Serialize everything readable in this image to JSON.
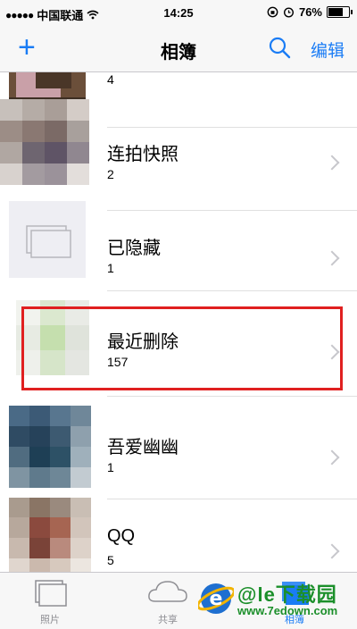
{
  "status_bar": {
    "carrier": "中国联通",
    "time": "14:25",
    "battery": "76%",
    "battery_level": 0.76,
    "signal_icon": "signal-dots-icon",
    "wifi_icon": "wifi-icon"
  },
  "nav_bar": {
    "add_label": "+",
    "title": "相簿",
    "edit_label": "编辑",
    "search_icon": "search-icon"
  },
  "albums": [
    {
      "name": "",
      "count": "4"
    },
    {
      "name": "连拍快照",
      "count": "2"
    },
    {
      "name": "已隐藏",
      "count": "1"
    },
    {
      "name": "最近删除",
      "count": "157"
    },
    {
      "name": "吾爱幽幽",
      "count": "1"
    },
    {
      "name": "QQ",
      "count": "5"
    }
  ],
  "tabs": [
    {
      "label": "照片",
      "icon": "photos-tab-icon"
    },
    {
      "label": "共享",
      "icon": "cloud-icon"
    },
    {
      "label": "相簿",
      "icon": "albums-tab-icon",
      "active": true
    }
  ],
  "watermark": {
    "brand": "@le下载园",
    "url": "www.7edown.com"
  },
  "colors": {
    "accent": "#1a7cf5",
    "highlight_border": "#e02020",
    "watermark": "#1b8f2a"
  }
}
